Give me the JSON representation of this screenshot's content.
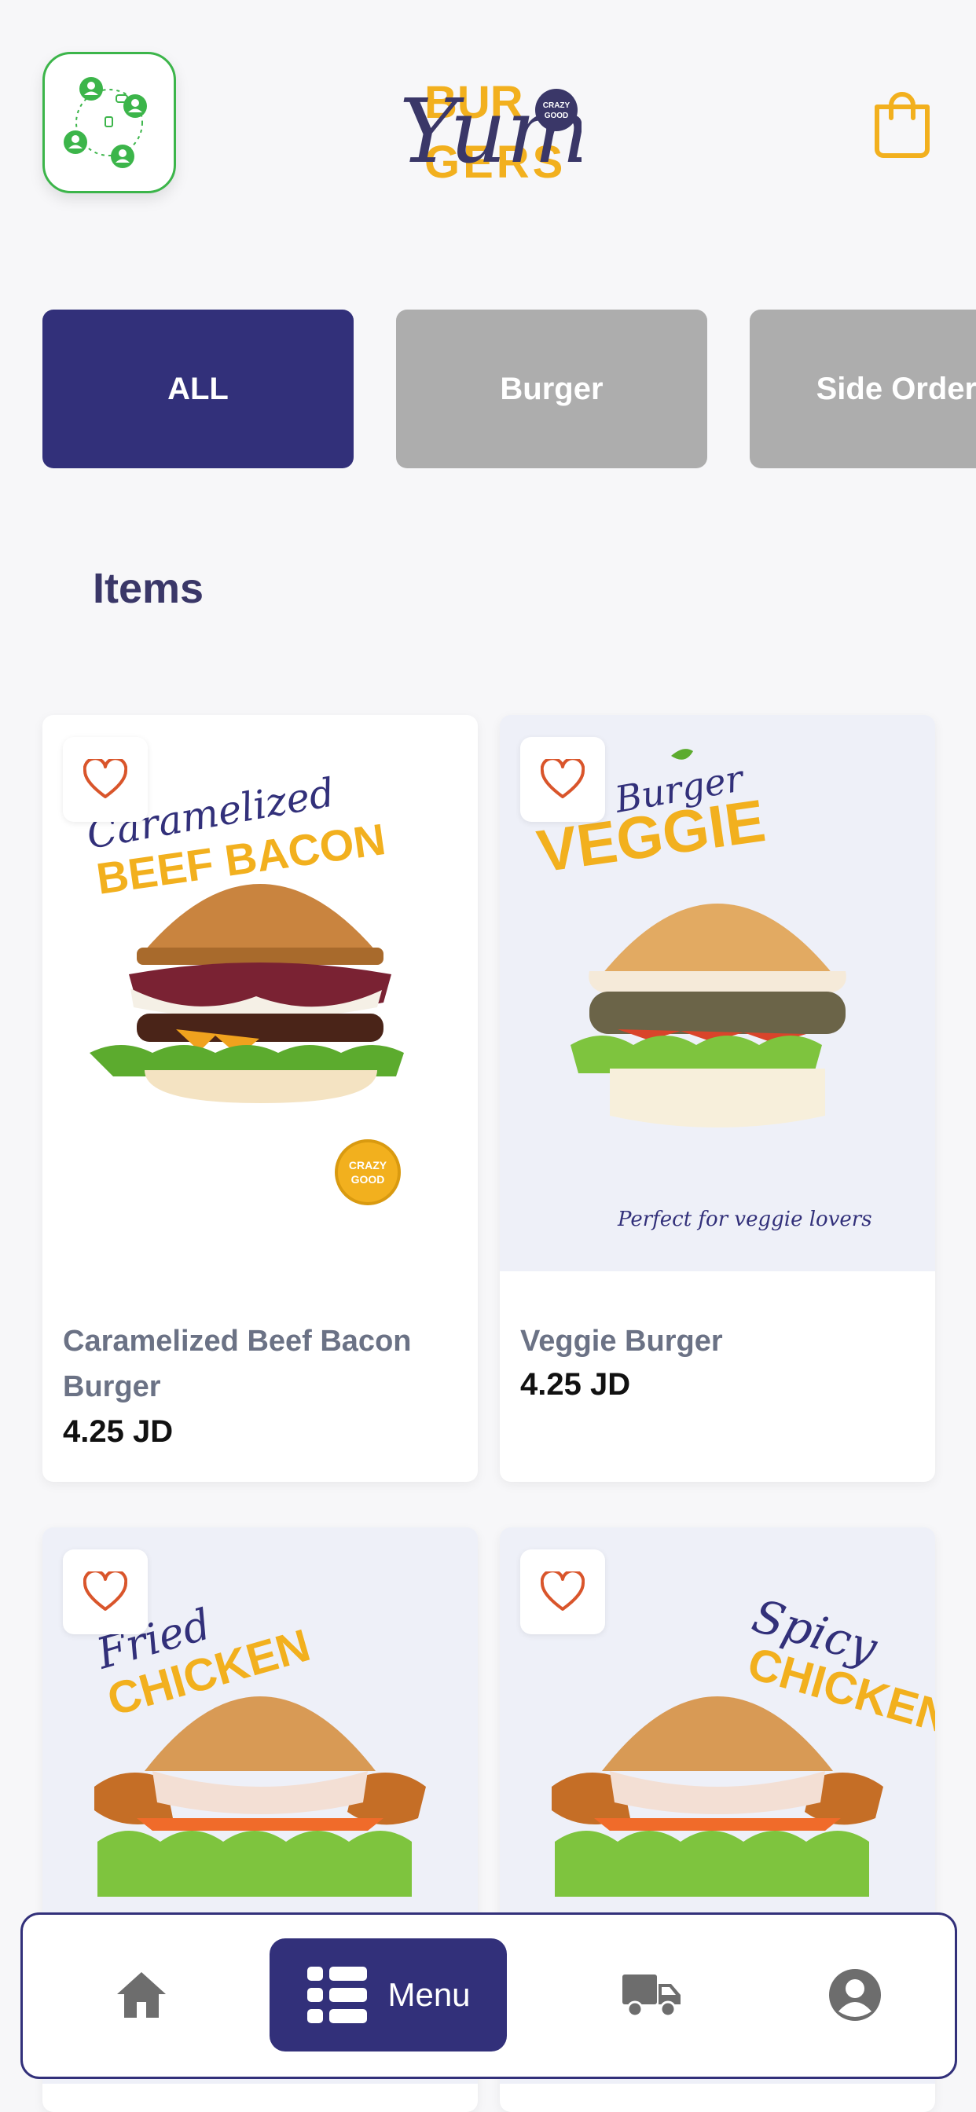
{
  "header": {
    "logo_text_top": "BUR",
    "logo_text_bottom": "GERS",
    "logo_script": "Yum",
    "logo_badge": "CRAZY GOOD",
    "icons": {
      "social": "people-network-icon",
      "cart": "shopping-bag-icon"
    }
  },
  "colors": {
    "primary": "#32307a",
    "inactive_tab": "#adadad",
    "accent_green": "#3cb54a",
    "accent_yellow": "#f2b01e",
    "heart": "#d9552b"
  },
  "tabs": [
    {
      "label": "ALL",
      "active": true
    },
    {
      "label": "Burger",
      "active": false
    },
    {
      "label": "Side Orders",
      "active": false
    }
  ],
  "section_title": "Items",
  "products": [
    {
      "name": "Caramelized Beef Bacon Burger",
      "price": "4.25 JD",
      "image_script": "Caramelized",
      "image_headline": "BEEF BACON",
      "image_badge": "CRAZY GOOD"
    },
    {
      "name": "Veggie Burger",
      "price": "4.25 JD",
      "image_script": "Burger",
      "image_headline": "VEGGIE",
      "image_tagline": "Perfect for veggie lovers"
    },
    {
      "name": "",
      "price": "",
      "image_script": "Fried",
      "image_headline": "CHICKEN"
    },
    {
      "name": "",
      "price": "",
      "image_script": "Spicy",
      "image_headline": "CHICKEN"
    }
  ],
  "bottom_nav": {
    "items": [
      {
        "icon": "home-icon",
        "label": ""
      },
      {
        "icon": "menu-list-icon",
        "label": "Menu"
      },
      {
        "icon": "delivery-truck-icon",
        "label": ""
      },
      {
        "icon": "user-profile-icon",
        "label": ""
      }
    ]
  }
}
